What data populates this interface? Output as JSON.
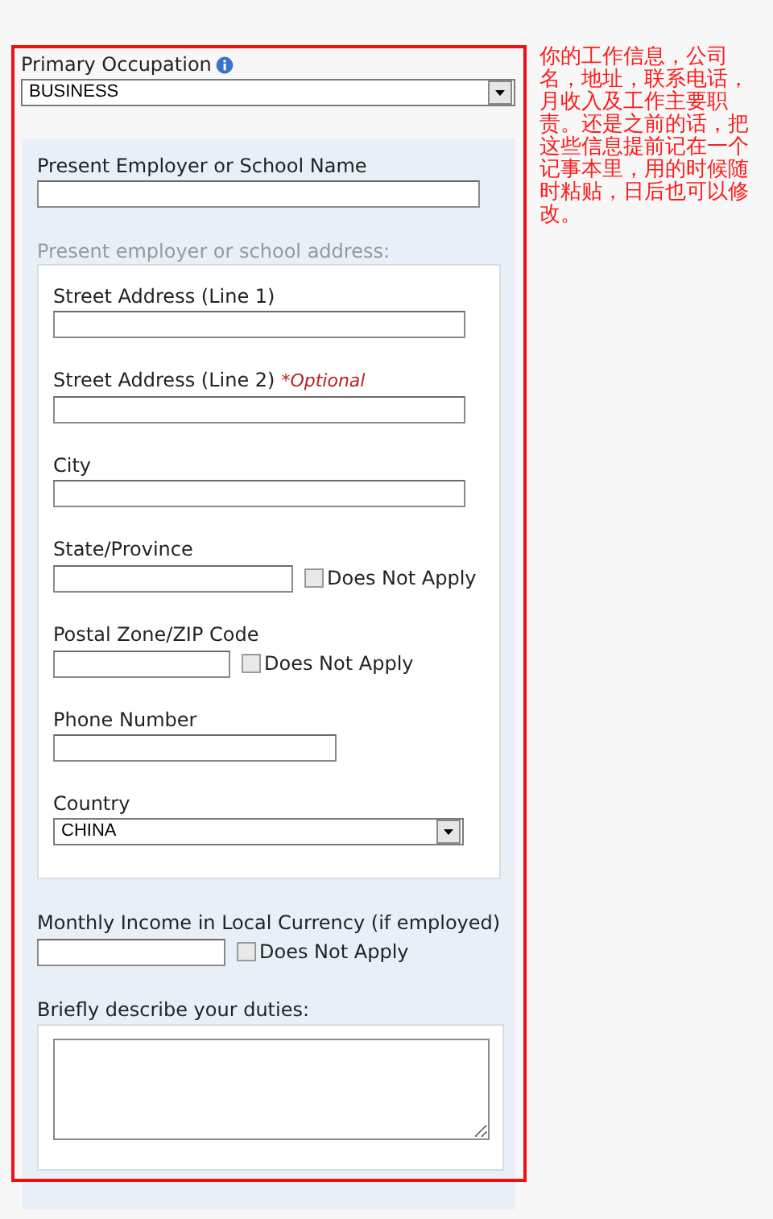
{
  "occupation": {
    "label": "Primary Occupation",
    "value": "BUSINESS"
  },
  "employer": {
    "label": "Present Employer or School Name"
  },
  "address": {
    "heading": "Present employer or school address:",
    "fields": [
      {
        "kind": "text",
        "label": "Street Address (Line 1)"
      },
      {
        "kind": "text",
        "label": "Street Address (Line 2)",
        "note": "*Optional"
      },
      {
        "kind": "text",
        "label": "City"
      },
      {
        "kind": "check",
        "label": "State/Province",
        "check_label": "Does Not Apply",
        "checked": false
      },
      {
        "kind": "check_short",
        "label": "Postal Zone/ZIP Code",
        "check_label": "Does Not Apply",
        "checked": false
      },
      {
        "kind": "short",
        "label": "Phone Number"
      },
      {
        "kind": "select",
        "label": "Country",
        "value": "CHINA"
      }
    ]
  },
  "income": {
    "label": "Monthly Income in Local Currency (if employed)",
    "check_label": "Does Not Apply",
    "checked": false
  },
  "duties": {
    "label": "Briefly describe your duties:"
  },
  "annotation": "你的工作信息，公司名，地址，联系电话，月收入及工作主要职责。还是之前的话，把这些信息提前记在一个记事本里，用的时候随时粘贴，日后也可以修改。"
}
